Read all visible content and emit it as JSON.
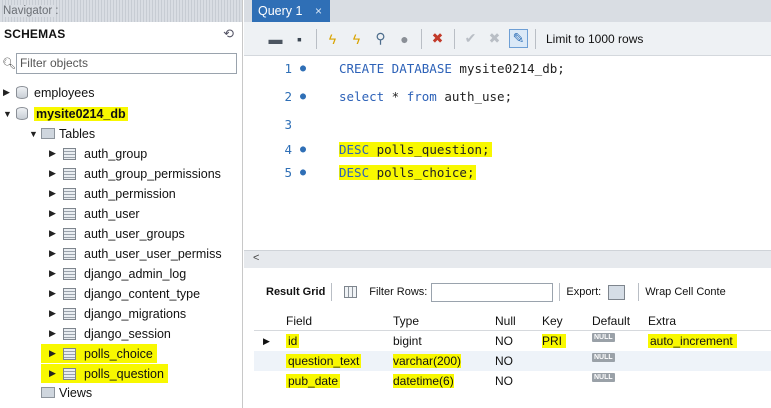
{
  "navigator": {
    "header": "Navigator",
    "schemas_title": "SCHEMAS",
    "filter_placeholder": "Filter objects",
    "tree": {
      "employees": "employees",
      "active_db": "mysite0214_db",
      "tables_label": "Tables",
      "tables": [
        "auth_group",
        "auth_group_permissions",
        "auth_permission",
        "auth_user",
        "auth_user_groups",
        "auth_user_user_permiss",
        "django_admin_log",
        "django_content_type",
        "django_migrations",
        "django_session",
        "polls_choice",
        "polls_question"
      ],
      "views_label": "Views"
    }
  },
  "query_tab": {
    "title": "Query 1",
    "close": "×"
  },
  "toolbar": {
    "limit_label": "Limit to 1000 rows"
  },
  "editor": {
    "lines": [
      {
        "num": "1",
        "dot": "●",
        "kw": "CREATE DATABASE",
        "rest": " mysite0214_db;"
      },
      {
        "num": "2",
        "dot": "●",
        "kw": "select",
        "rest": " * ",
        "kw2": "from",
        "rest2": " auth_use;"
      },
      {
        "num": "3",
        "dot": "",
        "kw": "",
        "rest": ""
      },
      {
        "num": "4",
        "dot": "●",
        "kw": "DESC",
        "rest": " polls_question;"
      },
      {
        "num": "5",
        "dot": "●",
        "kw": "DESC",
        "rest": " polls_choice;"
      }
    ]
  },
  "result_toolbar": {
    "result_grid": "Result Grid",
    "filter_rows": "Filter Rows:",
    "export": "Export:",
    "wrap": "Wrap Cell Conte"
  },
  "grid": {
    "columns": [
      "Field",
      "Type",
      "Null",
      "Key",
      "Default",
      "Extra"
    ],
    "rows": [
      {
        "field": "id",
        "type": "bigint",
        "null": "NO",
        "key": "PRI",
        "default": "NULL",
        "extra": "auto_increment"
      },
      {
        "field": "question_text",
        "type": "varchar(200)",
        "null": "NO",
        "key": "",
        "default": "NULL",
        "extra": ""
      },
      {
        "field": "pub_date",
        "type": "datetime(6)",
        "null": "NO",
        "key": "",
        "default": "NULL",
        "extra": ""
      }
    ]
  },
  "colors": {
    "highlight": "#f8f800",
    "tab_active": "#2f6fb6",
    "keyword": "#2d62b8"
  }
}
